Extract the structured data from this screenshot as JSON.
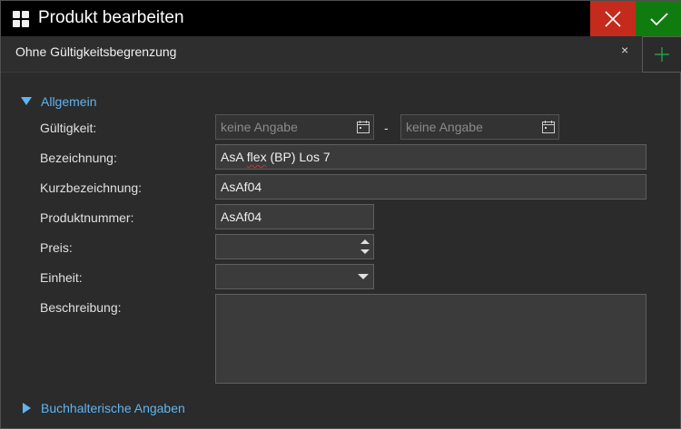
{
  "window": {
    "title": "Produkt bearbeiten"
  },
  "titlebar": {
    "close_icon": "close-icon",
    "confirm_icon": "check-icon"
  },
  "tab": {
    "label": "Ohne Gültigkeitsbegrenzung",
    "close_glyph": "×",
    "add_icon": "plus-icon"
  },
  "sections": {
    "general": {
      "label": "Allgemein",
      "expanded": true
    },
    "accounting": {
      "label": "Buchhalterische Angaben",
      "expanded": false
    }
  },
  "form": {
    "validity": {
      "label": "Gültigkeit:",
      "from_placeholder": "keine Angabe",
      "separator": "-",
      "to_placeholder": "keine Angabe"
    },
    "name": {
      "label": "Bezeichnung:",
      "value_prefix": "AsA ",
      "value_misspelled": "flex",
      "value_suffix": " (BP) Los 7"
    },
    "short_name": {
      "label": "Kurzbezeichnung:",
      "value": "AsAf04"
    },
    "product_number": {
      "label": "Produktnummer:",
      "value": "AsAf04"
    },
    "price": {
      "label": "Preis:",
      "value": ""
    },
    "unit": {
      "label": "Einheit:",
      "value": ""
    },
    "description": {
      "label": "Beschreibung:",
      "value": ""
    }
  },
  "colors": {
    "accent": "#5fb4f0",
    "close": "#c42b1c",
    "confirm": "#107c10"
  }
}
